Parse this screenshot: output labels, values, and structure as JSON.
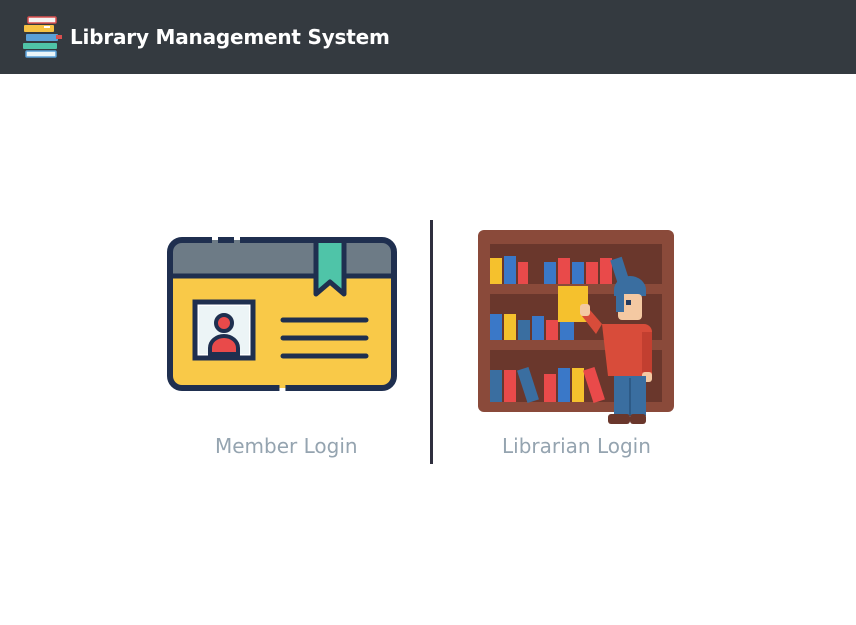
{
  "header": {
    "app_title": "Library Management System",
    "logo_icon": "books-stack-icon",
    "background": "#343a40"
  },
  "login_options": [
    {
      "label": "Member Login",
      "icon": "member-id-card-icon"
    },
    {
      "label": "Librarian Login",
      "icon": "librarian-bookshelf-icon"
    }
  ],
  "colors": {
    "label_text": "#95a4b0",
    "divider": "#2f2f3e"
  }
}
